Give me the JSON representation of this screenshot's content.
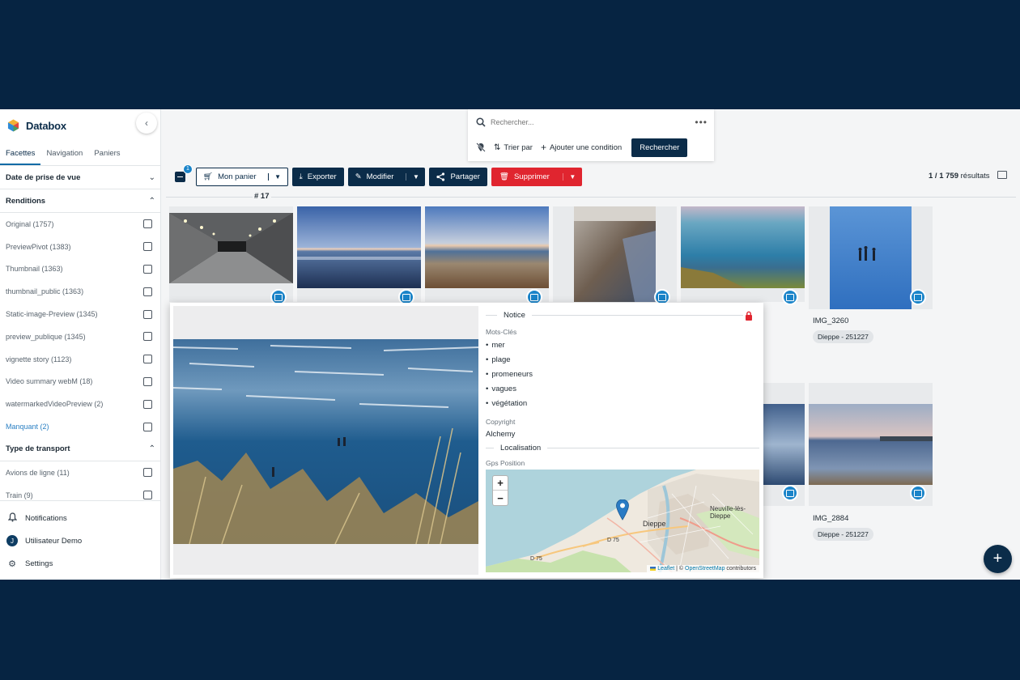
{
  "app": {
    "name": "Databox"
  },
  "sidebar": {
    "tabs": [
      "Facettes",
      "Navigation",
      "Paniers"
    ],
    "facet_groups": [
      {
        "title": "Date de prise de vue",
        "expanded": false,
        "items": []
      },
      {
        "title": "Renditions",
        "expanded": true,
        "items": [
          "Original (1757)",
          "PreviewPivot (1383)",
          "Thumbnail (1363)",
          "thumbnail_public (1363)",
          "Static-image-Preview (1345)",
          "preview_publique (1345)",
          "vignette story (1123)",
          "Video summary webM (18)",
          "watermarkedVideoPreview (2)",
          "Manquant (2)"
        ]
      },
      {
        "title": "Type de transport",
        "expanded": true,
        "items": [
          "Avions de ligne (11)",
          "Train (9)"
        ]
      }
    ],
    "bottom_links": {
      "notifications": "Notifications",
      "user_initial": "J",
      "user": "Utilisateur Demo",
      "settings": "Settings"
    }
  },
  "search": {
    "placeholder": "Rechercher...",
    "sort_label": "Trier par",
    "add_condition_label": "Ajouter une condition",
    "submit_label": "Rechercher"
  },
  "toolbar": {
    "selected_count": "1",
    "basket_label": "Mon panier",
    "export_label": "Exporter",
    "edit_label": "Modifier",
    "share_label": "Partager",
    "delete_label": "Supprimer",
    "results_count": "1 / 1 759",
    "results_suffix": "résultats"
  },
  "section": {
    "label": "# 17"
  },
  "thumbnails": [
    {
      "name": "IMG_3260",
      "tag": "Dieppe - 251227"
    },
    {
      "name": "IMG_2884",
      "tag": "Dieppe - 251227"
    }
  ],
  "preview": {
    "notice_title": "Notice",
    "keywords_label": "Mots-Clés",
    "keywords": [
      "mer",
      "plage",
      "promeneurs",
      "vagues",
      "végétation"
    ],
    "copyright_label": "Copyright",
    "copyright_value": "Alchemy",
    "location_title": "Localisation",
    "gps_label": "Gps Position",
    "map": {
      "zoom_in": "+",
      "zoom_out": "−",
      "labels": [
        "Neuville-lès-Dieppe",
        "Dieppe",
        "D 75",
        "D 75"
      ],
      "attribution": {
        "leaflet": "Leaflet",
        "sep": "| ©",
        "osm": "OpenStreetMap",
        "suffix": "contributors"
      }
    }
  },
  "fab_label": "+"
}
